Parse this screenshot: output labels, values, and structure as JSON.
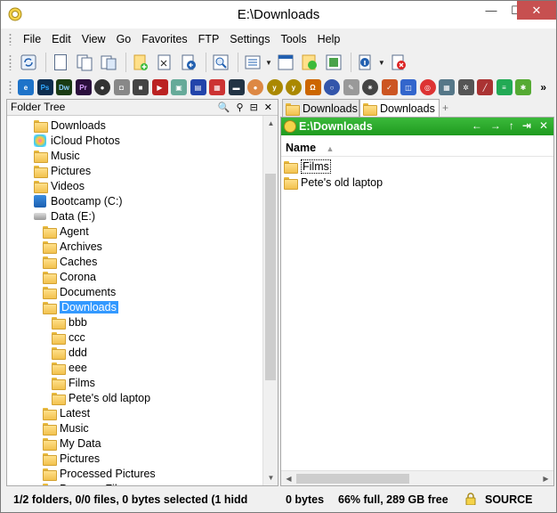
{
  "window": {
    "title": "E:\\Downloads"
  },
  "window_controls": {
    "minimize": "—",
    "maximize": "☐",
    "close": "✕"
  },
  "menu": [
    "File",
    "Edit",
    "View",
    "Go",
    "Favorites",
    "FTP",
    "Settings",
    "Tools",
    "Help"
  ],
  "toolbar2_more": "»",
  "left_pane": {
    "header": "Folder Tree",
    "header_icons": [
      "🔍",
      "⚲",
      "⊟",
      "✕"
    ],
    "tree": [
      {
        "label": "Downloads",
        "icon": "download-folder",
        "indent": 1
      },
      {
        "label": "iCloud Photos",
        "icon": "icloud-photos",
        "indent": 1
      },
      {
        "label": "Music",
        "icon": "music-folder",
        "indent": 1
      },
      {
        "label": "Pictures",
        "icon": "pictures-folder",
        "indent": 1
      },
      {
        "label": "Videos",
        "icon": "videos-folder",
        "indent": 1
      },
      {
        "label": "Bootcamp (C:)",
        "icon": "windows-drive",
        "indent": 1
      },
      {
        "label": "Data (E:)",
        "icon": "drive",
        "indent": 1
      },
      {
        "label": "Agent",
        "icon": "folder",
        "indent": 2
      },
      {
        "label": "Archives",
        "icon": "folder",
        "indent": 2
      },
      {
        "label": "Caches",
        "icon": "folder",
        "indent": 2
      },
      {
        "label": "Corona",
        "icon": "folder",
        "indent": 2
      },
      {
        "label": "Documents",
        "icon": "documents-folder",
        "indent": 2
      },
      {
        "label": "Downloads",
        "icon": "download-folder",
        "indent": 2,
        "selected": true
      },
      {
        "label": "bbb",
        "icon": "folder",
        "indent": 3
      },
      {
        "label": "ccc",
        "icon": "folder",
        "indent": 3
      },
      {
        "label": "ddd",
        "icon": "folder",
        "indent": 3
      },
      {
        "label": "eee",
        "icon": "folder",
        "indent": 3
      },
      {
        "label": "Films",
        "icon": "folder",
        "indent": 3
      },
      {
        "label": "Pete's old laptop",
        "icon": "folder",
        "indent": 3
      },
      {
        "label": "Latest",
        "icon": "folder",
        "indent": 2
      },
      {
        "label": "Music",
        "icon": "music-folder",
        "indent": 2
      },
      {
        "label": "My Data",
        "icon": "folder",
        "indent": 2
      },
      {
        "label": "Pictures",
        "icon": "pictures-folder",
        "indent": 2
      },
      {
        "label": "Processed Pictures",
        "icon": "folder",
        "indent": 2
      },
      {
        "label": "Program Files",
        "icon": "folder",
        "indent": 2
      }
    ],
    "scroll_up": "▲",
    "scroll_down": "▼"
  },
  "tabs": [
    {
      "label": "Downloads"
    },
    {
      "label": "Downloads",
      "active": true
    }
  ],
  "tab_add": "+",
  "right_pane": {
    "path": "E:\\Downloads",
    "path_nav_icons": [
      "←",
      "→",
      "↑",
      "⇥",
      "✕"
    ],
    "column_header": "Name",
    "sort_indicator": "▲",
    "files": [
      {
        "name": "Films",
        "focused": true
      },
      {
        "name": "Pete's old laptop"
      }
    ],
    "scroll_left": "◀",
    "scroll_right": "▶"
  },
  "status": {
    "selection": "1/2 folders, 0/0 files, 0 bytes selected (1 hidd",
    "size": "0 bytes",
    "disk": "66% full, 289 GB free",
    "mode": "SOURCE"
  },
  "colors": {
    "path_bar": "#1f9a1f",
    "selection": "#3399ff",
    "folder": "#f2c14e"
  }
}
